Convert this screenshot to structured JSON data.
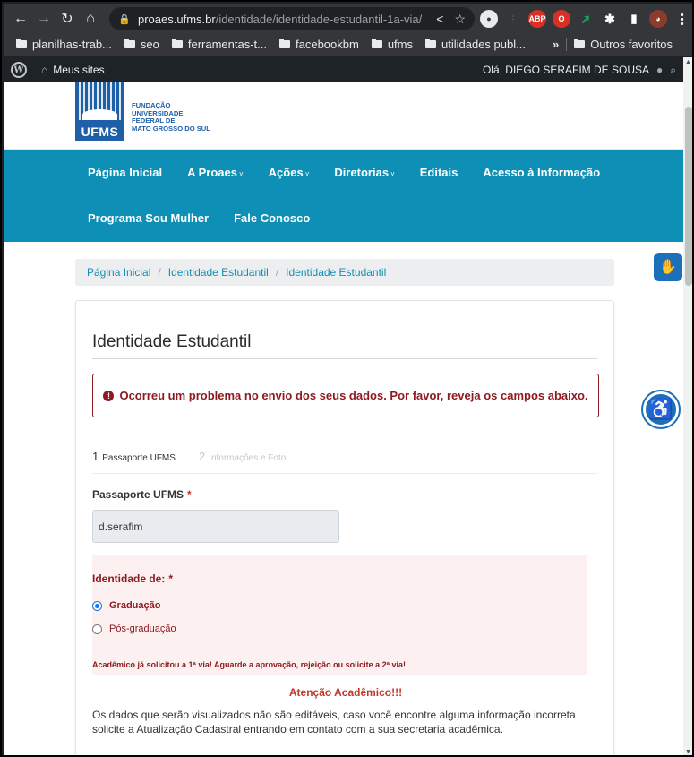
{
  "browser": {
    "url_host": "proaes.ufms.br",
    "url_path": "/identidade/identidade-estudantil-1a-via/",
    "bookmarks": [
      "planilhas-trab...",
      "seo",
      "ferramentas-t...",
      "facebookbm",
      "ufms",
      "utilidades publ..."
    ],
    "overflow": "»",
    "other_favorites": "Outros favoritos",
    "ext_labels": [
      "ABP",
      "O"
    ]
  },
  "wp_bar": {
    "sites": "Meus sites",
    "greeting": "Olá, DIEGO SERAFIM DE SOUSA"
  },
  "logo": {
    "mark": "UFMS",
    "line1": "FUNDAÇÃO",
    "line2": "UNIVERSIDADE",
    "line3": "FEDERAL DE",
    "line4": "MATO GROSSO DO SUL"
  },
  "nav": {
    "row1": [
      {
        "label": "Página Inicial",
        "caret": ""
      },
      {
        "label": "A Proaes",
        "caret": "˅"
      },
      {
        "label": "Ações",
        "caret": "˅"
      },
      {
        "label": "Diretorias",
        "caret": "˅"
      },
      {
        "label": "Editais",
        "caret": ""
      },
      {
        "label": "Acesso à Informação",
        "caret": ""
      }
    ],
    "row2": [
      {
        "label": "Programa Sou Mulher"
      },
      {
        "label": "Fale Conosco"
      }
    ]
  },
  "breadcrumb": [
    "Página Inicial",
    "Identidade Estudantil",
    "Identidade Estudantil"
  ],
  "form": {
    "title": "Identidade Estudantil",
    "alert": "Ocorreu um problema no envio dos seus dados. Por favor, reveja os campos abaixo.",
    "step1_num": "1",
    "step1": "Passaporte UFMS",
    "step2_num": "2",
    "step2": "Informações e Foto",
    "passaporte_label": "Passaporte UFMS",
    "required_mark": "*",
    "passaporte_value": "d.serafim",
    "identidade_label": "Identidade de:",
    "option_graduacao": "Graduação",
    "option_pos": "Pós-graduação",
    "error_msg": "Acadêmico já solicitou a 1ª via! Aguarde a aprovação, rejeição ou solicite a 2ª via!",
    "attention": "Atenção Acadêmico!!!",
    "para1": "Os dados que serão visualizados não são editáveis, caso você encontre alguma informação incorreta solicite a Atualização Cadastral entrando em contato com a sua secretaria acadêmica."
  },
  "colors": {
    "nav_bg": "#0e8fb5",
    "error": "#8e1b22",
    "link": "#138eb3"
  }
}
